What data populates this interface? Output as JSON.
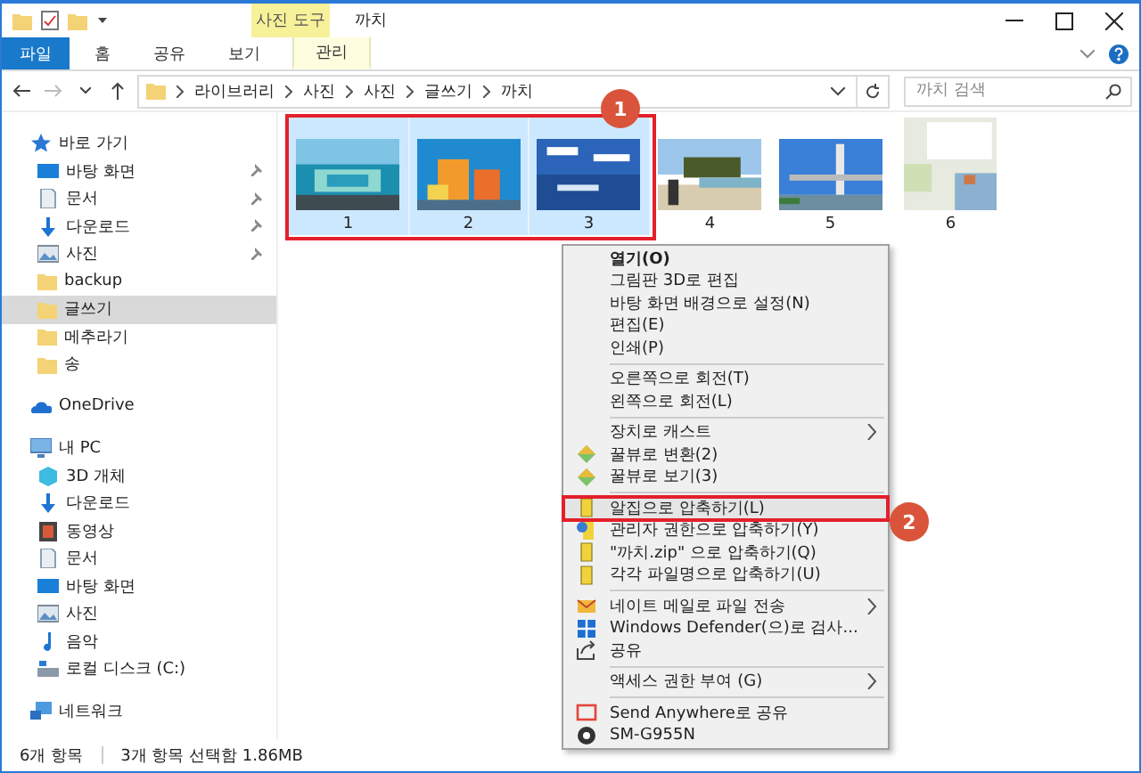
{
  "window": {
    "title": "까치",
    "context_tab": "사진 도구"
  },
  "ribbon": {
    "tabs": [
      {
        "label": "파일",
        "kind": "file",
        "selected": false
      },
      {
        "label": "홈",
        "kind": "tab",
        "selected": false
      },
      {
        "label": "공유",
        "kind": "tab",
        "selected": false
      },
      {
        "label": "보기",
        "kind": "tab",
        "selected": false
      },
      {
        "label": "관리",
        "kind": "context",
        "selected": true
      }
    ]
  },
  "address": {
    "path": [
      "라이브러리",
      "사진",
      "사진",
      "글쓰기",
      "까치"
    ],
    "search": {
      "placeholder": "까치 검색"
    }
  },
  "sidebar": {
    "items": [
      {
        "label": "바로 가기",
        "selected": false,
        "children": [
          {
            "label": "바탕 화면",
            "pinned": true,
            "selected": false
          },
          {
            "label": "문서",
            "pinned": true,
            "selected": false
          },
          {
            "label": "다운로드",
            "pinned": true,
            "selected": false
          },
          {
            "label": "사진",
            "pinned": true,
            "selected": false
          },
          {
            "label": "backup",
            "pinned": false,
            "selected": false
          },
          {
            "label": "글쓰기",
            "pinned": false,
            "selected": true
          },
          {
            "label": "메추라기",
            "pinned": false,
            "selected": false
          },
          {
            "label": "송",
            "pinned": false,
            "selected": false
          }
        ]
      },
      {
        "label": "OneDrive",
        "selected": false
      },
      {
        "label": "내 PC",
        "selected": false,
        "children": [
          {
            "label": "3D 개체",
            "selected": false
          },
          {
            "label": "다운로드",
            "selected": false
          },
          {
            "label": "동영상",
            "selected": false
          },
          {
            "label": "문서",
            "selected": false
          },
          {
            "label": "바탕 화면",
            "selected": false
          },
          {
            "label": "사진",
            "selected": false
          },
          {
            "label": "음악",
            "selected": false
          },
          {
            "label": "로컬 디스크 (C:)",
            "selected": false
          }
        ]
      },
      {
        "label": "네트워크",
        "selected": false
      }
    ]
  },
  "files": [
    {
      "label": "1",
      "selected": true
    },
    {
      "label": "2",
      "selected": true
    },
    {
      "label": "3",
      "selected": true
    },
    {
      "label": "4",
      "selected": false
    },
    {
      "label": "5",
      "selected": false
    },
    {
      "label": "6",
      "selected": false
    }
  ],
  "context_menu": {
    "items": [
      {
        "kind": "item",
        "label": "열기(O)",
        "bold": true
      },
      {
        "kind": "item",
        "label": "그림판 3D로 편집"
      },
      {
        "kind": "item",
        "label": "바탕 화면 배경으로 설정(N)"
      },
      {
        "kind": "item",
        "label": "편집(E)"
      },
      {
        "kind": "item",
        "label": "인쇄(P)"
      },
      {
        "kind": "separator"
      },
      {
        "kind": "item",
        "label": "오른쪽으로 회전(T)"
      },
      {
        "kind": "item",
        "label": "왼쪽으로 회전(L)"
      },
      {
        "kind": "separator"
      },
      {
        "kind": "item",
        "label": "장치로 캐스트",
        "submenu": true
      },
      {
        "kind": "item",
        "label": "꿀뷰로 변환(2)"
      },
      {
        "kind": "item",
        "label": "꿀뷰로 보기(3)"
      },
      {
        "kind": "separator"
      },
      {
        "kind": "item",
        "label": "알집으로 압축하기(L)",
        "highlighted": true
      },
      {
        "kind": "item",
        "label": "관리자 권한으로 압축하기(Y)"
      },
      {
        "kind": "item",
        "label": "\"까치.zip\" 으로 압축하기(Q)"
      },
      {
        "kind": "item",
        "label": "각각 파일명으로 압축하기(U)"
      },
      {
        "kind": "separator"
      },
      {
        "kind": "item",
        "label": "네이트 메일로 파일 전송",
        "submenu": true
      },
      {
        "kind": "item",
        "label": "Windows Defender(으)로 검사..."
      },
      {
        "kind": "item",
        "label": "공유"
      },
      {
        "kind": "separator"
      },
      {
        "kind": "item",
        "label": "액세스 권한 부여 (G)",
        "submenu": true
      },
      {
        "kind": "separator"
      },
      {
        "kind": "item",
        "label": "Send Anywhere로 공유"
      },
      {
        "kind": "item",
        "label": "SM-G955N"
      }
    ]
  },
  "annotations": [
    {
      "label": "1"
    },
    {
      "label": "2"
    }
  ],
  "status_bar": {
    "count": "6개 항목",
    "selection": "3개 항목 선택함 1.86MB"
  }
}
